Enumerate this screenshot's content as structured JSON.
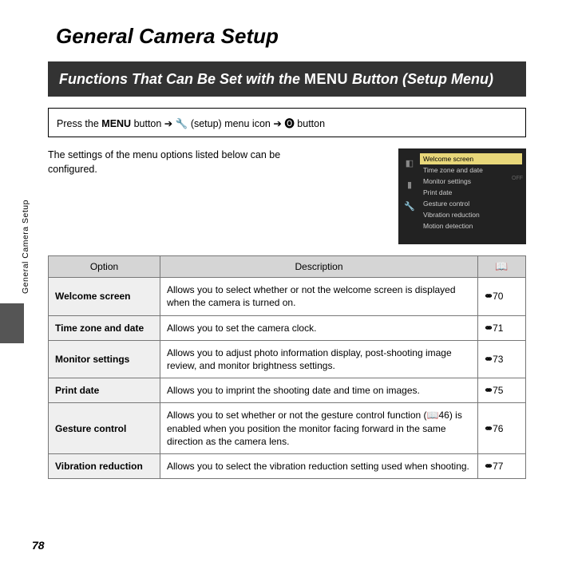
{
  "sideLabel": "General Camera Setup",
  "title": "General Camera Setup",
  "band": {
    "prefix": "Functions That Can Be Set with the ",
    "menuWord": "MENU",
    "suffix": " Button (Setup Menu)"
  },
  "instruction": {
    "p1": "Press the ",
    "menuWord": "MENU",
    "p2": " button ",
    "arrow1": "➔",
    "wrench": "🔧",
    "p3": " (setup) menu icon ",
    "arrow2": "➔",
    "ok": "🅞",
    "p4": " button"
  },
  "intro": "The settings of the menu options listed below can be configured.",
  "thumb": {
    "items": [
      "Welcome screen",
      "Time zone and date",
      "Monitor settings",
      "Print date",
      "Gesture control",
      "Vibration reduction",
      "Motion detection"
    ],
    "vals": [
      "",
      "",
      "OFF",
      "",
      "",
      ""
    ]
  },
  "headers": {
    "opt": "Option",
    "desc": "Description",
    "ref": "📖"
  },
  "refPrefix": "⚭",
  "bookRef": "📖",
  "rows": [
    {
      "opt": "Welcome screen",
      "desc": "Allows you to select whether or not the welcome screen is displayed when the camera is turned on.",
      "ref": "70"
    },
    {
      "opt": "Time zone and date",
      "desc": "Allows you to set the camera clock.",
      "ref": "71"
    },
    {
      "opt": "Monitor settings",
      "desc": "Allows you to adjust photo information display, post-shooting image review, and monitor brightness settings.",
      "ref": "73"
    },
    {
      "opt": "Print date",
      "desc": "Allows you to imprint the shooting date and time on images.",
      "ref": "75"
    },
    {
      "opt": "Gesture control",
      "descPre": "Allows you to set whether or not the gesture control function (",
      "descMid": "46",
      "descPost": ") is enabled when you position the monitor facing forward in the same direction as the camera lens.",
      "ref": "76"
    },
    {
      "opt": "Vibration reduction",
      "desc": "Allows you to select the vibration reduction setting used when shooting.",
      "ref": "77"
    }
  ],
  "pageNum": "78"
}
